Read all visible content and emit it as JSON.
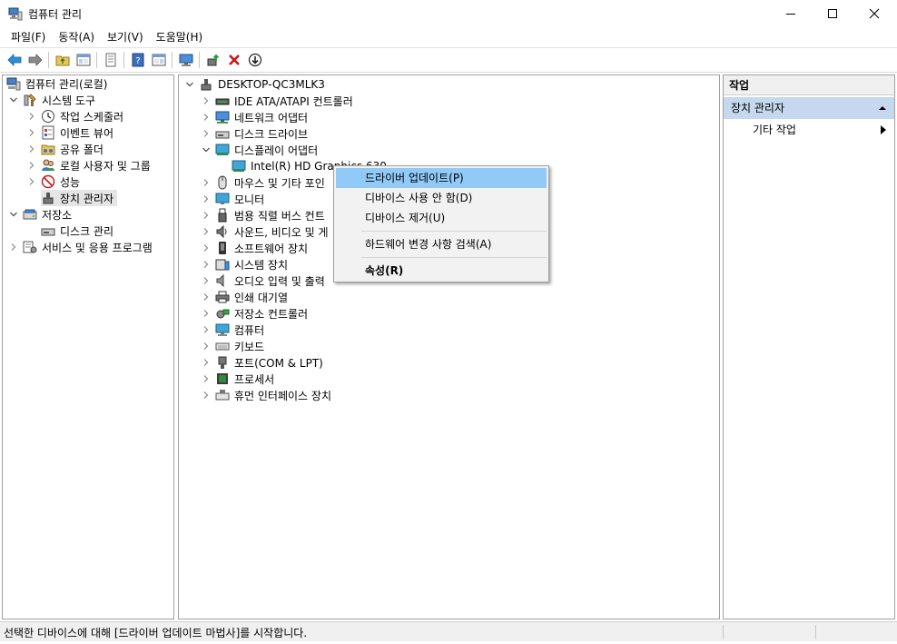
{
  "window": {
    "title": "컴퓨터 관리"
  },
  "menu": [
    "파일(F)",
    "동작(A)",
    "보기(V)",
    "도움말(H)"
  ],
  "left_tree": {
    "root": "컴퓨터 관리(로컬)",
    "system_tools": "시스템 도구",
    "task_scheduler": "작업 스케줄러",
    "event_viewer": "이벤트 뷰어",
    "shared_folders": "공유 폴더",
    "local_users": "로컬 사용자 및 그룹",
    "performance": "성능",
    "device_manager": "장치 관리자",
    "storage": "저장소",
    "disk_management": "디스크 관리",
    "services_apps": "서비스 및 응용 프로그램"
  },
  "device_tree": {
    "computer": "DESKTOP-QC3MLK3",
    "categories": [
      "IDE ATA/ATAPI 컨트롤러",
      "네트워크 어댑터",
      "디스크 드라이브",
      "디스플레이 어댑터",
      "마우스 및 기타 포인",
      "모니터",
      "범용 직렬 버스 컨트",
      "사운드, 비디오 및 게",
      "소프트웨어 장치",
      "시스템 장치",
      "오디오 입력 및 출력",
      "인쇄 대기열",
      "저장소 컨트롤러",
      "컴퓨터",
      "키보드",
      "포트(COM & LPT)",
      "프로세서",
      "휴먼 인터페이스 장치"
    ],
    "display_child": "Intel(R) HD Graphics 630"
  },
  "context_menu": {
    "update_driver": "드라이버 업데이트(P)",
    "disable_device": "디바이스 사용 안 함(D)",
    "uninstall_device": "디바이스 제거(U)",
    "scan_hardware": "하드웨어 변경 사항 검색(A)",
    "properties": "속성(R)"
  },
  "actions_pane": {
    "header": "작업",
    "section": "장치 관리자",
    "more_actions": "기타 작업"
  },
  "status": {
    "text": "선택한 디바이스에 대해 [드라이버 업데이트 마법사]를 시작합니다."
  },
  "colors": {
    "highlight": "#91c9f7",
    "section_bg": "#c5d8ee",
    "selected_row": "#e5e5e5"
  }
}
